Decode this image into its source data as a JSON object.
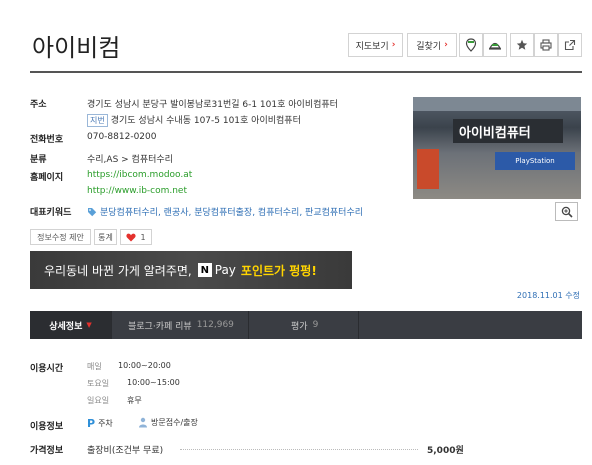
{
  "place": {
    "name": "아이비컴"
  },
  "toolbar": {
    "map_label": "지도보기",
    "route_label": "길찾기",
    "chevron": "›"
  },
  "info": {
    "address_label": "주소",
    "address_road": "경기도 성남시 분당구 발이봉남로31번길 6-1 101호 아이비컴퓨터",
    "jibun_tag": "지번",
    "address_jibun": "경기도 성남시 수내동 107-5 101호 아이비컴퓨터",
    "phone_label": "전화번호",
    "phone": "070-8812-0200",
    "category_label": "분류",
    "category": "수리,AS > 컴퓨터수리",
    "homepage_label": "홈페이지",
    "homepage_1": "https://ibcom.modoo.at",
    "homepage_2": "http://www.ib-com.net",
    "keywords_label": "대표키워드",
    "keywords": "분당컴퓨터수리, 랜공사, 분당컴퓨터출장, 컴퓨터수리, 판교컴퓨터수리"
  },
  "photo": {
    "sign_text": "아이비컴퓨터",
    "sign2_text": "PlayStation"
  },
  "actions": {
    "edit_label": "정보수정 제안",
    "stats_label": "통계",
    "like_count": "1"
  },
  "banner": {
    "text": "우리동네 바뀐 가게 알려주면,",
    "npay_n": "N",
    "npay_label": "Pay",
    "highlight": "포인트가 펑펑!"
  },
  "update": {
    "text": "2018.11.01 수정"
  },
  "tabs": [
    {
      "label": "상세정보",
      "count": ""
    },
    {
      "label": "블로그·카페 리뷰",
      "count": "112,969"
    },
    {
      "label": "평가",
      "count": "9"
    }
  ],
  "hours": {
    "label": "이용시간",
    "rows": [
      {
        "day": "매일",
        "time": "10:00~20:00"
      },
      {
        "day": "토요일",
        "time": "10:00~15:00"
      },
      {
        "day": "일요일",
        "time": "휴무"
      }
    ]
  },
  "services": {
    "label": "이용정보",
    "parking": "주차",
    "visit": "방문접수/출장"
  },
  "price": {
    "label": "가격정보",
    "item": "출장비(조건부 무료)",
    "value": "5,000원"
  },
  "colors": {
    "accent_red": "#e4312d",
    "link_green": "#2a9d2a",
    "link_blue": "#2f6fb5",
    "tab_bar": "#3a3d43"
  }
}
